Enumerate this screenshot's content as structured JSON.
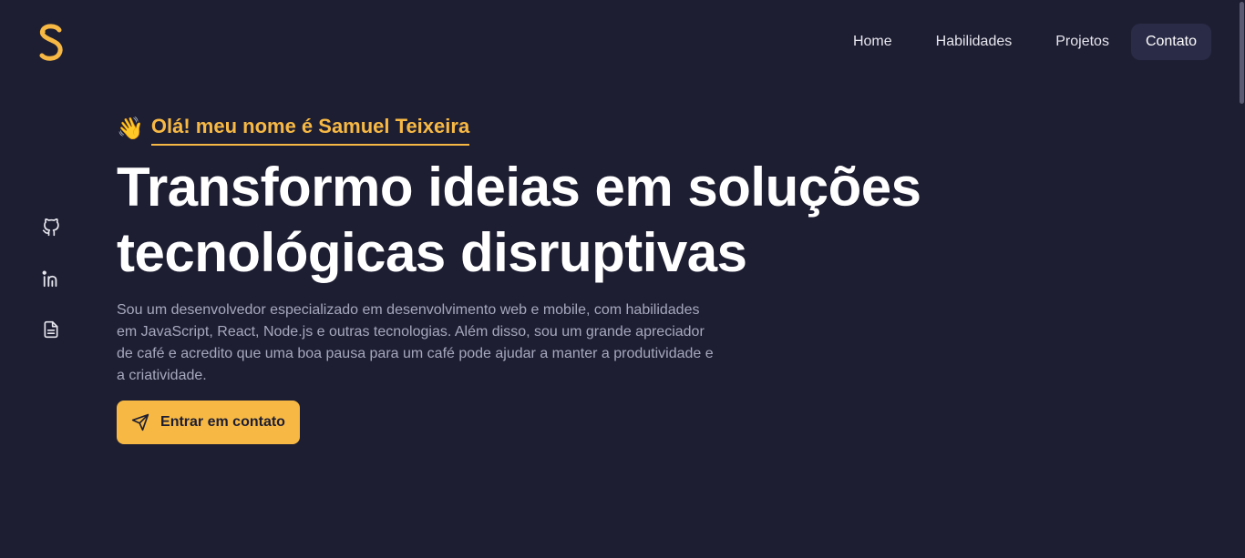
{
  "logo": {
    "letter": "S",
    "color": "#f7b944"
  },
  "nav": {
    "items": [
      {
        "label": "Home"
      },
      {
        "label": "Habilidades"
      },
      {
        "label": "Projetos"
      },
      {
        "label": "Contato"
      }
    ]
  },
  "social": {
    "items": [
      {
        "icon": "github-icon"
      },
      {
        "icon": "linkedin-icon"
      },
      {
        "icon": "document-icon"
      }
    ]
  },
  "hero": {
    "wave_emoji": "👋",
    "greeting": "Olá! meu nome é Samuel Teixeira",
    "headline": "Transformo ideias em soluções tecnológicas disruptivas",
    "description": "Sou um desenvolvedor especializado em desenvolvimento web e mobile, com habilidades em JavaScript, React, Node.js e outras tecnologias. Além disso, sou um grande apreciador de café e acredito que uma boa pausa para um café pode ajudar a manter a produtividade e a criatividade.",
    "cta_label": "Entrar em contato",
    "cta_icon": "send-icon"
  },
  "colors": {
    "background": "#1e1e33",
    "accent": "#f7b944",
    "text": "#ffffff",
    "muted_text": "#a6a8bd",
    "nav_active_bg": "#2a2b47"
  }
}
